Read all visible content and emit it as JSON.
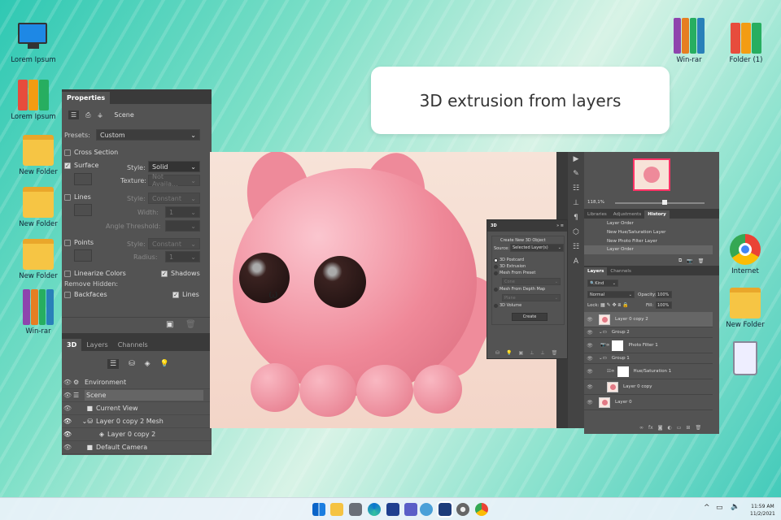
{
  "desktop": {
    "left_icons": [
      {
        "label": "Lorem Ipsum",
        "icon": "computer-icon"
      },
      {
        "label": "Lorem Ipsum",
        "icon": "books-icon"
      },
      {
        "label": "New Folder",
        "icon": "folder-icon"
      },
      {
        "label": "New Folder",
        "icon": "folder-icon"
      },
      {
        "label": "New Folder",
        "icon": "folder-icon"
      },
      {
        "label": "Win-rar",
        "icon": "winrar-icon"
      }
    ],
    "right_icons": [
      {
        "label": "Win-rar",
        "icon": "winrar-icon"
      },
      {
        "label": "Folder (1)",
        "icon": "books-icon"
      },
      {
        "label": "Internet",
        "icon": "chrome-icon"
      },
      {
        "label": "New Folder",
        "icon": "folder-icon"
      },
      {
        "label": "",
        "icon": "recycle-bin-icon"
      }
    ]
  },
  "caption": "3D extrusion from layers",
  "properties": {
    "tab": "Properties",
    "mode": "Scene",
    "presets_label": "Presets:",
    "presets_value": "Custom",
    "cross_section": "Cross Section",
    "surface": "Surface",
    "style_label": "Style:",
    "surface_style": "Solid",
    "texture_label": "Texture:",
    "texture_value": "Not Availa...",
    "lines": "Lines",
    "lines_style": "Constant",
    "width_label": "Width:",
    "width_value": "1",
    "angle_label": "Angle Threshold:",
    "points": "Points",
    "points_style": "Constant",
    "radius_label": "Radius:",
    "radius_value": "1",
    "linearize": "Linearize Colors",
    "shadows": "Shadows",
    "remove_hidden": "Remove Hidden:",
    "backfaces": "Backfaces",
    "lines_cb": "Lines"
  },
  "scene_panel": {
    "tabs": [
      "3D",
      "Layers",
      "Channels"
    ],
    "items": [
      {
        "label": "Environment",
        "icon": "environment-icon"
      },
      {
        "label": "Scene",
        "icon": "scene-icon"
      },
      {
        "label": "Current View",
        "icon": "camera-icon"
      },
      {
        "label": "Layer 0 copy 2 Mesh",
        "icon": "mesh-icon"
      },
      {
        "label": "Layer 0 copy 2",
        "icon": "material-icon"
      },
      {
        "label": "Default Camera",
        "icon": "camera-icon"
      }
    ]
  },
  "panel3d": {
    "title": "3D",
    "heading": "Create New 3D Object",
    "source_label": "Source:",
    "source_value": "Selected Layer(s)",
    "options": [
      "3D Postcard",
      "3D Extrusion",
      "Mesh From Preset",
      "Mesh From Depth Map",
      "3D Volume"
    ],
    "preset_value": "Cone",
    "depth_value": "Plane",
    "create": "Create"
  },
  "navigator": {
    "zoom": "118,1%"
  },
  "history": {
    "tabs": [
      "Libraries",
      "Adjustments",
      "History"
    ],
    "items": [
      "Layer Order",
      "New Hue/Saturation Layer",
      "New Photo Filter Layer",
      "Layer Order"
    ]
  },
  "layers": {
    "tabs": [
      "Layers",
      "Channels"
    ],
    "filter": "Kind",
    "blend": "Normal",
    "opacity_label": "Opacity:",
    "opacity": "100%",
    "lock_label": "Lock:",
    "fill_label": "Fill:",
    "fill": "100%",
    "items": [
      "Layer 0 copy 2",
      "Group 2",
      "Photo Filter 1",
      "Group 1",
      "Hue/Saturation 1",
      "Layer 0 copy",
      "Layer 0"
    ]
  },
  "taskbar": {
    "time": "11:59 AM",
    "date": "11/2/2021"
  },
  "colors": {
    "accent": "#2fc8b3",
    "panel": "#535353",
    "cat": "#f08a9c"
  }
}
